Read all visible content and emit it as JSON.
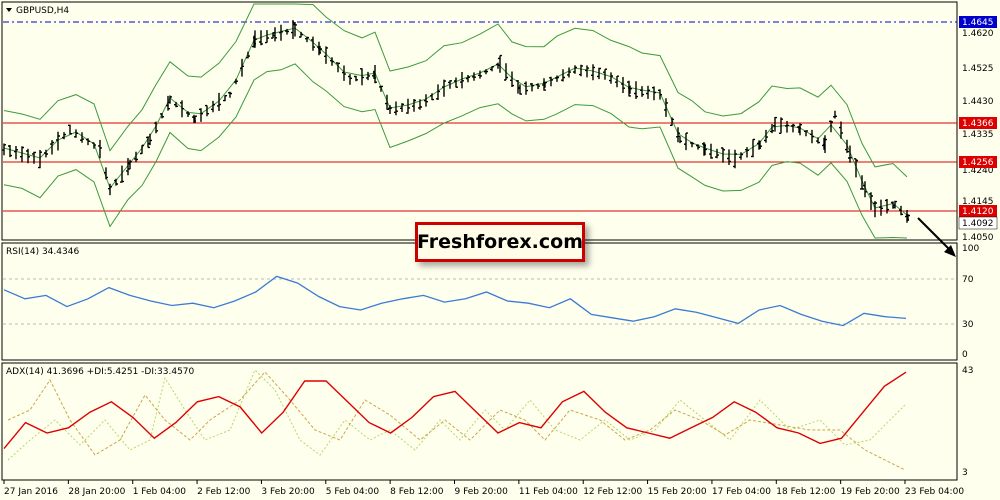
{
  "window": {
    "symbol_title": "GBPUSD,H4"
  },
  "brand": {
    "text": "Freshforex.com"
  },
  "levels": {
    "dashed_blue": "1.4645",
    "red_lines": [
      "1.4366",
      "1.4256",
      "1.4120"
    ],
    "current_price": "1.4092"
  },
  "colors": {
    "background": "#ffffee",
    "candles": "#000000",
    "bollinger": "#3c9a3c",
    "resistance": "#dd0000",
    "blue_level": "#0000cc",
    "rsi": "#3a7bd5",
    "adx": "#dd0000",
    "di_plus": "#7ab800",
    "di_minus": "#c9a64a"
  },
  "price_axis": [
    "1.4620",
    "1.4525",
    "1.4430",
    "1.4335",
    "1.4240",
    "1.4145",
    "1.4050"
  ],
  "rsi": {
    "label": "RSI(14) 34.4346",
    "axis": [
      "100",
      "70",
      "30",
      "0"
    ]
  },
  "adx": {
    "label": "ADX(14) 41.3696 +DI:5.4251 -DI:33.4570",
    "axis": [
      "43",
      "3"
    ]
  },
  "time_axis": [
    "27 Jan 2016",
    "28 Jan 20:00",
    "1 Feb 04:00",
    "2 Feb 12:00",
    "3 Feb 20:00",
    "5 Feb 04:00",
    "8 Feb 12:00",
    "9 Feb 20:00",
    "11 Feb 04:00",
    "12 Feb 12:00",
    "15 Feb 20:00",
    "17 Feb 04:00",
    "18 Feb 12:00",
    "19 Feb 20:00",
    "23 Feb 04:00"
  ],
  "chart_data": {
    "type": "line",
    "series": [
      {
        "name": "RSI(14)",
        "values": [
          60,
          52,
          55,
          45,
          52,
          62,
          55,
          50,
          46,
          48,
          44,
          50,
          58,
          72,
          66,
          54,
          45,
          42,
          48,
          52,
          55,
          49,
          52,
          58,
          50,
          48,
          44,
          52,
          38,
          35,
          32,
          36,
          43,
          40,
          35,
          30,
          42,
          46,
          38,
          32,
          28,
          39,
          36,
          34.4346
        ]
      },
      {
        "name": "ADX(14)",
        "values": [
          12,
          22,
          18,
          20,
          26,
          30,
          24,
          16,
          22,
          30,
          32,
          28,
          18,
          26,
          38,
          38,
          30,
          22,
          18,
          24,
          32,
          34,
          26,
          18,
          22,
          20,
          30,
          34,
          26,
          20,
          18,
          16,
          20,
          24,
          30,
          26,
          20,
          18,
          14,
          16,
          26,
          36,
          41.3696
        ]
      }
    ]
  }
}
